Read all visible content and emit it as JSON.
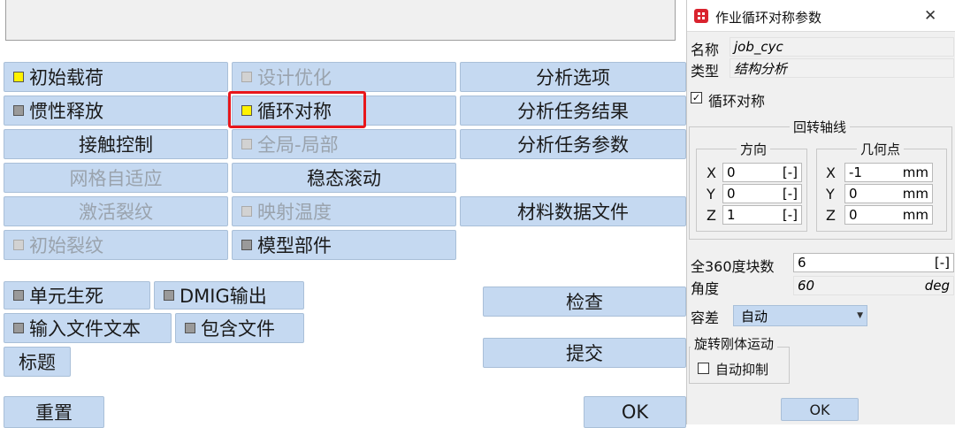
{
  "main": {
    "grid": {
      "initial_load": "初始载荷",
      "design_opt": "设计优化",
      "analysis_options": "分析选项",
      "inertia_release": "惯性释放",
      "cyclic_symmetry": "循环对称",
      "analysis_results": "分析任务结果",
      "contact_control": "接触控制",
      "global_local": "全局-局部",
      "analysis_params": "分析任务参数",
      "mesh_adaptive": "网格自适应",
      "steady_rolling": "稳态滚动",
      "activate_crack": "激活裂纹",
      "map_temperature": "映射温度",
      "material_file": "材料数据文件",
      "initial_crack": "初始裂纹",
      "model_parts": "模型部件"
    },
    "element_birth_death": "单元生死",
    "dmig_output": "DMIG输出",
    "input_text": "输入文件文本",
    "include_file": "包含文件",
    "title": "标题",
    "check": "检查",
    "submit": "提交",
    "reset": "重置",
    "ok": "OK"
  },
  "dialog": {
    "title": "作业循环对称参数",
    "close": "✕",
    "name_label": "名称",
    "name_value": "job_cyc",
    "type_label": "类型",
    "type_value": "结构分析",
    "cyclic_checkbox_label": "循环对称",
    "cyclic_checked": true,
    "axis_group": "回转轴线",
    "direction_group": "方向",
    "point_group": "几何点",
    "dir": [
      {
        "axis": "X",
        "value": "0",
        "unit": "[-]"
      },
      {
        "axis": "Y",
        "value": "0",
        "unit": "[-]"
      },
      {
        "axis": "Z",
        "value": "1",
        "unit": "[-]"
      }
    ],
    "pt": [
      {
        "axis": "X",
        "value": "-1",
        "unit": "mm"
      },
      {
        "axis": "Y",
        "value": "0",
        "unit": "mm"
      },
      {
        "axis": "Z",
        "value": "0",
        "unit": "mm"
      }
    ],
    "sectors_label": "全360度块数",
    "sectors_value": "6",
    "sectors_unit": "[-]",
    "angle_label": "角度",
    "angle_value": "60",
    "angle_unit": "deg",
    "tolerance_label": "容差",
    "tolerance_value": "自动",
    "rigid_group": "旋转刚体运动",
    "auto_suppress": "自动抑制",
    "ok": "OK"
  },
  "colors": {
    "button_bg": "#c5d9f1",
    "highlight": "#e8161b",
    "dialog_bg": "#f0f0f0"
  }
}
